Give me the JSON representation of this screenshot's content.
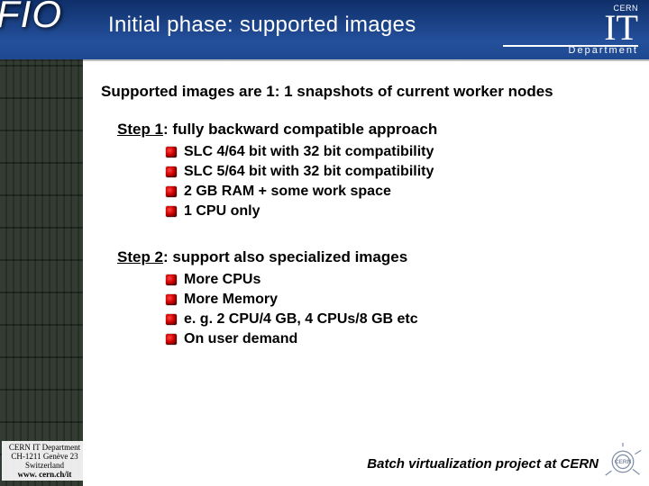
{
  "header": {
    "fio": "FIO",
    "title": "Initial phase: supported images",
    "cern_small": "CERN",
    "cern_it": "IT",
    "cern_dept": "Department"
  },
  "content": {
    "intro": "Supported images are 1: 1 snapshots of current worker nodes",
    "step1": {
      "label": "Step 1",
      "rest": ": fully backward compatible approach",
      "bullets": [
        "SLC 4/64 bit with 32 bit compatibility",
        "SLC 5/64 bit with 32 bit compatibility",
        "2 GB RAM + some work space",
        "1 CPU only"
      ]
    },
    "step2": {
      "label": "Step 2",
      "rest": ": support also specialized images",
      "bullets": [
        "More CPUs",
        "More Memory",
        "e. g. 2 CPU/4 GB, 4 CPUs/8 GB etc",
        "On user demand"
      ]
    }
  },
  "footer": {
    "addr_line1": "CERN IT Department",
    "addr_line2": "CH-1211 Genève 23",
    "addr_line3": "Switzerland",
    "addr_line4": "www. cern.ch/it",
    "caption": "Batch virtualization project at CERN"
  }
}
